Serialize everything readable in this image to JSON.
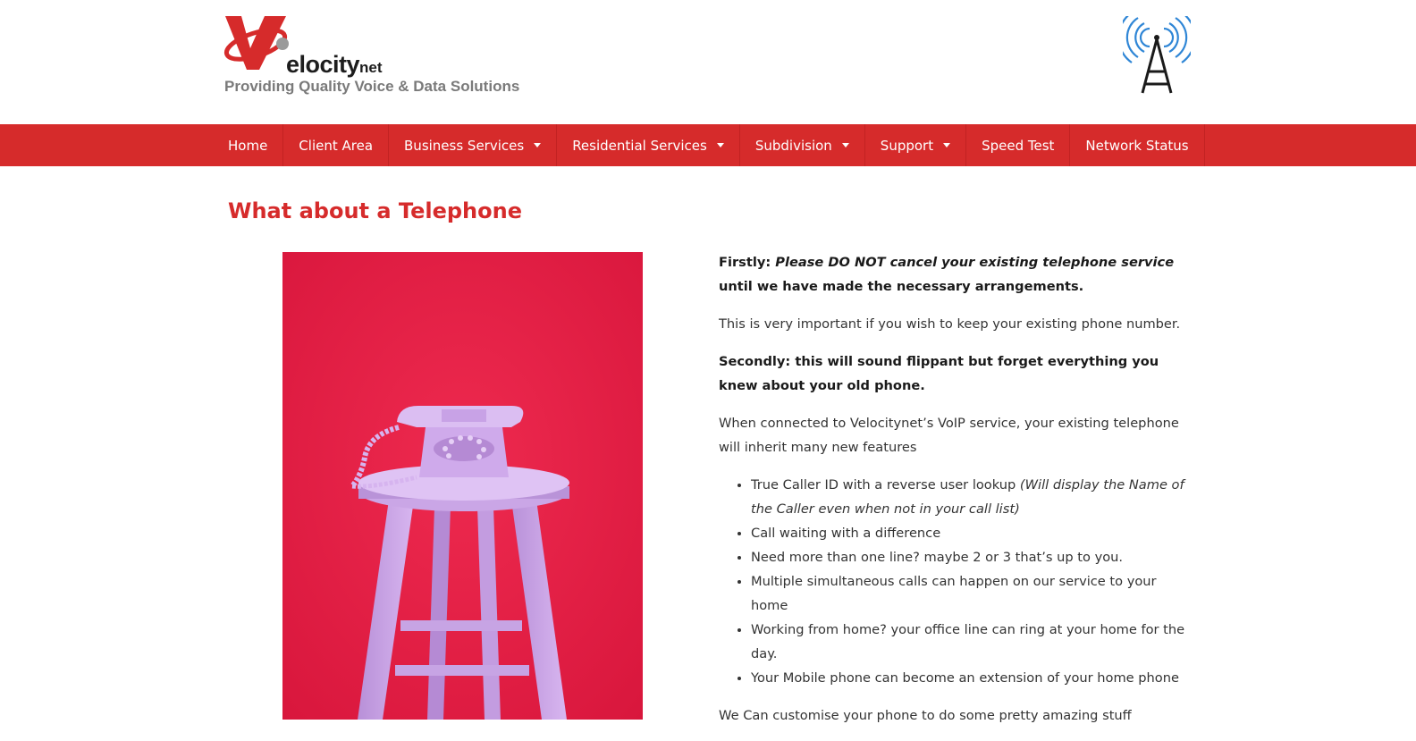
{
  "brand": {
    "logo_letter": "V",
    "name": "elocity",
    "name_suffix": "net",
    "tagline": "Providing Quality Voice & Data Solutions",
    "colors": {
      "accent": "#d62b2b",
      "tower_waves": "#2f86d6"
    }
  },
  "icons": {
    "tower": "radio-tower-icon",
    "dropdown": "caret-down-icon"
  },
  "nav": {
    "items": [
      {
        "label": "Home",
        "dropdown": false
      },
      {
        "label": "Client Area",
        "dropdown": false
      },
      {
        "label": "Business Services",
        "dropdown": true
      },
      {
        "label": "Residential Services",
        "dropdown": true
      },
      {
        "label": "Subdivision",
        "dropdown": true
      },
      {
        "label": "Support",
        "dropdown": true
      },
      {
        "label": "Speed Test",
        "dropdown": false
      },
      {
        "label": "Network Status",
        "dropdown": false
      }
    ]
  },
  "page": {
    "title": "What about a Telephone",
    "image_alt": "Pink rotary telephone on a stool against a red wall"
  },
  "content": {
    "p1_lead": "Firstly: ",
    "p1_emph": "Please DO NOT cancel your existing telephone service",
    "p1_tail": " until we have made the necessary arrangements.",
    "p2": "This is very important if you wish to keep your existing phone number.",
    "p3": "Secondly: this will sound flippant but forget everything you knew about your old phone.",
    "p4": "When connected to Velocitynet’s VoIP service, your existing telephone will inherit many new features",
    "features": [
      {
        "text": "True Caller ID with a reverse user lookup ",
        "note": "(Will display the Name of the Caller even when not in your call list)"
      },
      {
        "text": "Call waiting with a difference",
        "note": ""
      },
      {
        "text": "Need more than one line? maybe 2 or 3 that’s up to you.",
        "note": ""
      },
      {
        "text": "Multiple simultaneous calls can happen on our service to your home",
        "note": ""
      },
      {
        "text": "Working from home? your office line can ring at your home for the day.",
        "note": ""
      },
      {
        "text": "Your Mobile phone can become an extension of your home phone",
        "note": ""
      }
    ],
    "p5": "We Can customise your phone to do some pretty amazing stuff"
  }
}
